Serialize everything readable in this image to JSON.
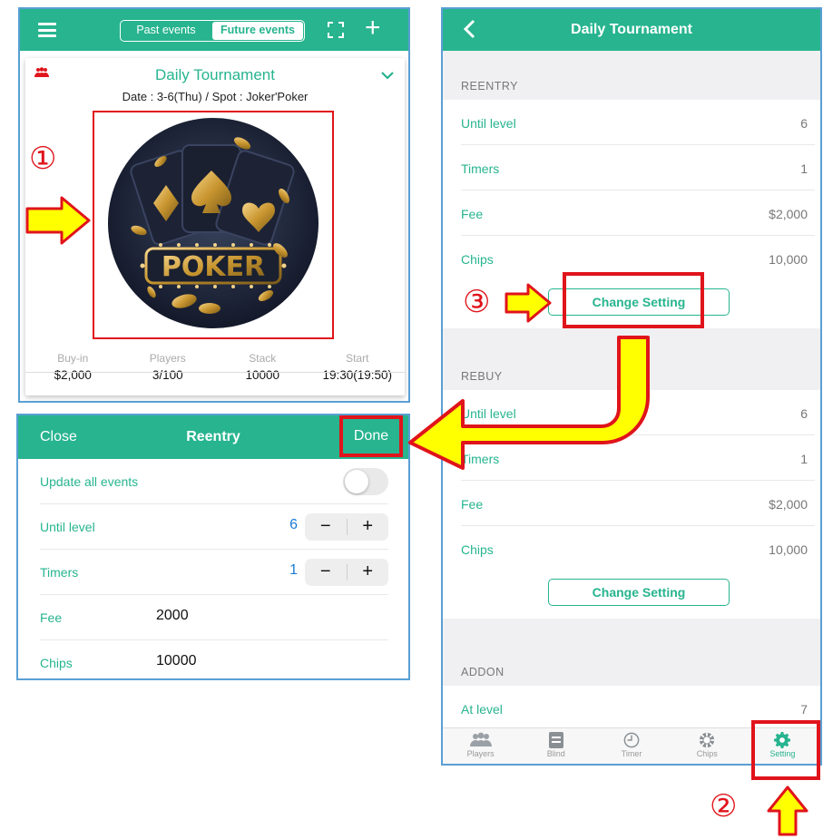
{
  "annotations": {
    "step1": "①",
    "step2": "②",
    "step3": "③"
  },
  "event_list": {
    "tabs": {
      "past": "Past events",
      "future": "Future events"
    },
    "event": {
      "title": "Daily Tournament",
      "subtitle": "Date : 3-6(Thu) / Spot : Joker'Poker",
      "image_text": "POKER",
      "stats": [
        {
          "label": "Buy-in",
          "value": "$2,000"
        },
        {
          "label": "Players",
          "value": "3/100"
        },
        {
          "label": "Stack",
          "value": "10000"
        },
        {
          "label": "Start",
          "value": "19:30(19:50)"
        }
      ]
    }
  },
  "reentry_editor": {
    "close": "Close",
    "title": "Reentry",
    "done": "Done",
    "update_all": "Update all events",
    "until_level": {
      "label": "Until level",
      "value": "6"
    },
    "timers": {
      "label": "Timers",
      "value": "1"
    },
    "fee": {
      "label": "Fee",
      "value": "2000"
    },
    "chips": {
      "label": "Chips",
      "value": "10000"
    },
    "minus": "−",
    "plus": "+"
  },
  "tournament": {
    "title": "Daily Tournament",
    "change_setting": "Change Setting",
    "reentry": {
      "header": "REENTRY",
      "rows": [
        {
          "label": "Until level",
          "value": "6"
        },
        {
          "label": "Timers",
          "value": "1"
        },
        {
          "label": "Fee",
          "value": "$2,000"
        },
        {
          "label": "Chips",
          "value": "10,000"
        }
      ]
    },
    "rebuy": {
      "header": "REBUY",
      "rows": [
        {
          "label": "Until level",
          "value": "6"
        },
        {
          "label": "Timers",
          "value": "1"
        },
        {
          "label": "Fee",
          "value": "$2,000"
        },
        {
          "label": "Chips",
          "value": "10,000"
        }
      ]
    },
    "addon": {
      "header": "ADDON",
      "rows": [
        {
          "label": "At level",
          "value": "7"
        }
      ]
    },
    "tabs": [
      {
        "label": "Players",
        "icon": "players-icon"
      },
      {
        "label": "Blind",
        "icon": "blind-icon"
      },
      {
        "label": "Timer",
        "icon": "timer-icon"
      },
      {
        "label": "Chips",
        "icon": "chips-icon"
      },
      {
        "label": "Setting",
        "icon": "gear-icon",
        "active": true
      }
    ]
  },
  "colors": {
    "accent": "#27b48f",
    "highlight": "#e0141b",
    "arrow": "#ffff00"
  }
}
